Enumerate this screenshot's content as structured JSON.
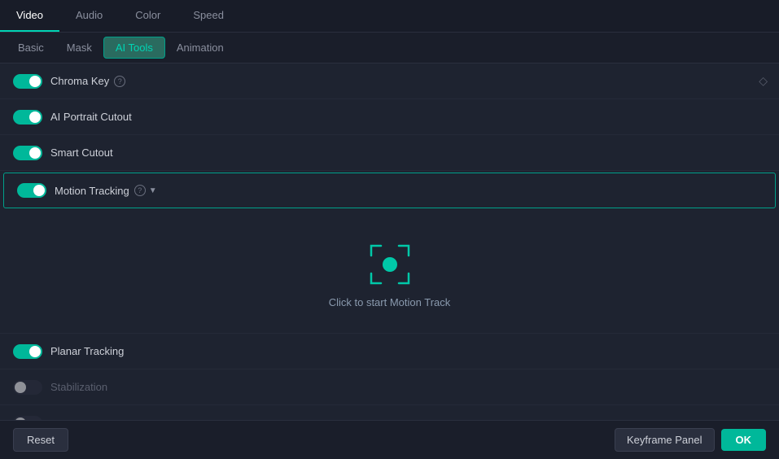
{
  "top_tabs": {
    "tabs": [
      {
        "id": "video",
        "label": "Video",
        "active": true
      },
      {
        "id": "audio",
        "label": "Audio",
        "active": false
      },
      {
        "id": "color",
        "label": "Color",
        "active": false
      },
      {
        "id": "speed",
        "label": "Speed",
        "active": false
      }
    ]
  },
  "sub_tabs": {
    "tabs": [
      {
        "id": "basic",
        "label": "Basic",
        "active": false
      },
      {
        "id": "mask",
        "label": "Mask",
        "active": false
      },
      {
        "id": "ai-tools",
        "label": "AI Tools",
        "active": true
      },
      {
        "id": "animation",
        "label": "Animation",
        "active": false
      }
    ]
  },
  "toggles": [
    {
      "id": "chroma-key",
      "label": "Chroma Key",
      "on": true,
      "has_help": true,
      "has_diamond": true,
      "dimmed": false
    },
    {
      "id": "ai-portrait",
      "label": "AI Portrait Cutout",
      "on": true,
      "has_help": false,
      "has_diamond": false,
      "dimmed": false
    },
    {
      "id": "smart-cutout",
      "label": "Smart Cutout",
      "on": true,
      "has_help": false,
      "has_diamond": false,
      "dimmed": false
    },
    {
      "id": "motion-tracking",
      "label": "Motion Tracking",
      "on": true,
      "has_help": true,
      "has_chevron": true,
      "highlighted": true,
      "dimmed": false
    }
  ],
  "motion_track": {
    "label": "Click to start Motion Track",
    "icon_alt": "motion-track-icon"
  },
  "bottom_section": {
    "toggles": [
      {
        "id": "planar-tracking",
        "label": "Planar Tracking",
        "on": true,
        "dimmed": false
      },
      {
        "id": "stabilization",
        "label": "Stabilization",
        "on": false,
        "dimmed": true
      }
    ]
  },
  "bottom_bar": {
    "reset_label": "Reset",
    "keyframe_label": "Keyframe Panel",
    "ok_label": "OK"
  }
}
